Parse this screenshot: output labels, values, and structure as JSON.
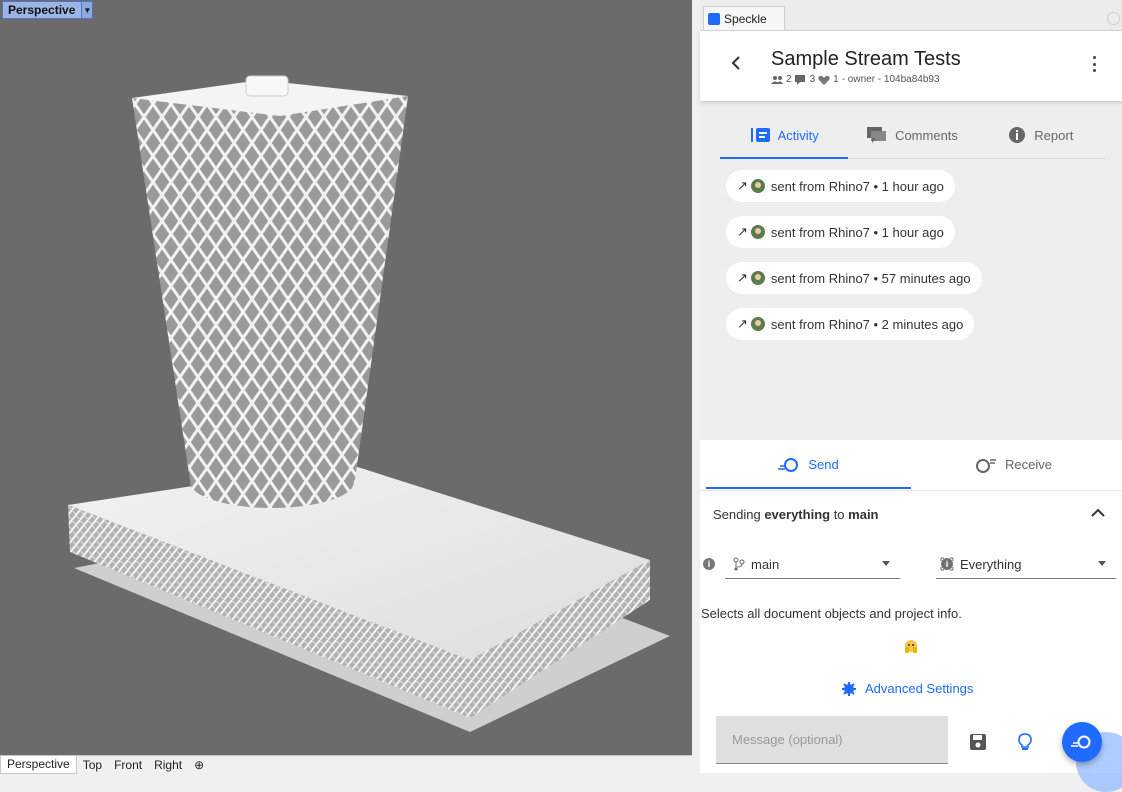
{
  "viewport": {
    "label": "Perspective",
    "tabs": [
      "Perspective",
      "Top",
      "Front",
      "Right"
    ]
  },
  "panel": {
    "tab_label": "Speckle",
    "stream": {
      "title": "Sample Stream Tests",
      "collaborators": "2",
      "comments": "3",
      "favorites": "1",
      "meta_suffix": "- owner - 104ba84b93"
    },
    "tabs": [
      {
        "label": "Activity",
        "active": true
      },
      {
        "label": "Comments",
        "active": false
      },
      {
        "label": "Report",
        "active": false
      }
    ],
    "activity": [
      {
        "text": "sent from Rhino7 • 1 hour ago"
      },
      {
        "text": "sent from Rhino7 • 1 hour ago"
      },
      {
        "text": "sent from Rhino7 • 57 minutes ago"
      },
      {
        "text": "sent from Rhino7 • 2 minutes ago"
      }
    ],
    "mode_tabs": {
      "send": "Send",
      "receive": "Receive"
    },
    "sending": {
      "prefix": "Sending ",
      "what": "everything",
      "mid": " to ",
      "branch": "main"
    },
    "branch_select": "main",
    "filter_select": "Everything",
    "description": "Selects all document objects and project info.",
    "advanced": "Advanced Settings",
    "message_placeholder": "Message (optional)"
  },
  "colors": {
    "accent": "#1f6bff",
    "viewport_bg": "#6b6b6b"
  }
}
